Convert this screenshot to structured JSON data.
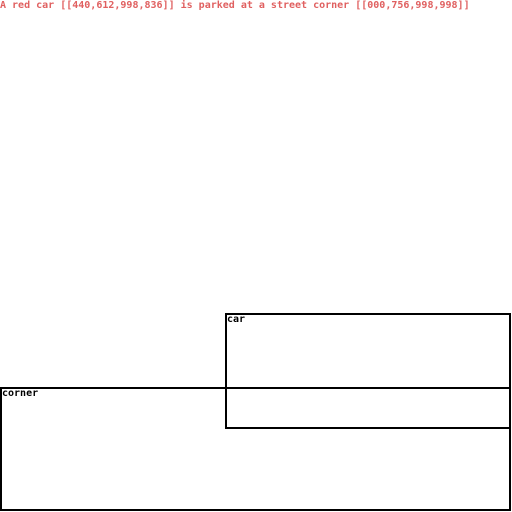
{
  "caption": "A red car [[440,612,998,836]] is parked at a street corner [[000,756,998,998]]",
  "colors": {
    "caption": "#e06060",
    "box_border": "#000000"
  },
  "boxes": [
    {
      "label": "car"
    },
    {
      "label": "corner"
    }
  ]
}
